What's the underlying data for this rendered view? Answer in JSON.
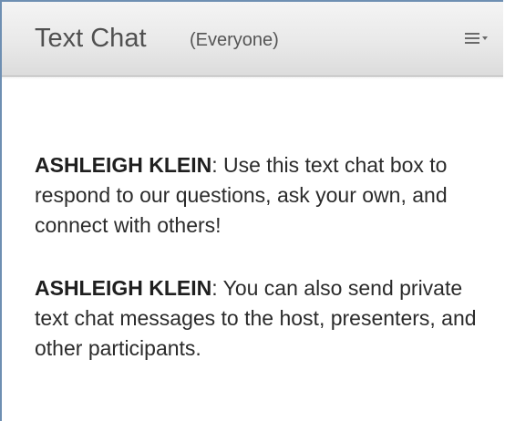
{
  "pod": {
    "title": "Text Chat",
    "audience": "(Everyone)",
    "menu_icon": "hamburger-menu-dropdown-icon"
  },
  "messages": [
    {
      "sender": "ASHLEIGH KLEIN",
      "text": ": Use this text chat box to respond to our questions, ask your own, and connect with others!"
    },
    {
      "sender": "ASHLEIGH KLEIN",
      "text": ": You can also send private text chat messages to the host, presenters, and other participants."
    }
  ],
  "colors": {
    "border": "#6e8fb2",
    "header_bg": "#e9e9e9",
    "text": "#2b2b2b"
  }
}
